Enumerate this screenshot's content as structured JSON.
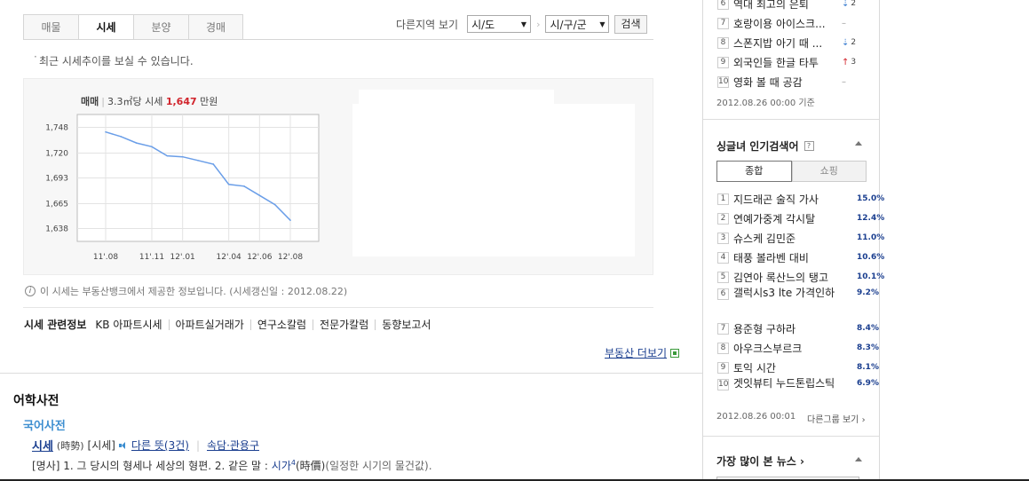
{
  "tabs": [
    {
      "label": "매물"
    },
    {
      "label": "시세"
    },
    {
      "label": "분양"
    },
    {
      "label": "경매"
    }
  ],
  "region": {
    "label": "다른지역 보기",
    "sido": "시/도",
    "sigungu": "시/구/군",
    "search_button": "검색"
  },
  "notice": "최근 시세추이를 보실 수 있습니다.",
  "chart_header": {
    "deal_type": "매매",
    "unit_area": "3.3㎡당 시세",
    "price": "1,647",
    "unit": "만원"
  },
  "chart_data": {
    "type": "line",
    "title": "",
    "xlabel": "",
    "ylabel": "",
    "x_ticks": [
      "11'.08",
      "11'.11",
      "12'.01",
      "12'.04",
      "12'.06",
      "12'.08"
    ],
    "y_ticks": [
      "1,748",
      "1,720",
      "1,693",
      "1,665",
      "1,638"
    ],
    "ylim": [
      1624,
      1762
    ],
    "grid": true,
    "series": [
      {
        "x": [
          "11'.08",
          "11'.09",
          "11'.10",
          "11'.11",
          "11'.12",
          "12'.01",
          "12'.02",
          "12'.03",
          "12'.04",
          "12'.05",
          "12'.06",
          "12'.07",
          "12'.08"
        ],
        "values": [
          1743,
          1738,
          1731,
          1727,
          1717,
          1716,
          1712,
          1708,
          1686,
          1684,
          1674,
          1664,
          1647
        ]
      }
    ],
    "line_color": "#6a9ee8"
  },
  "source_note": "이 시세는 부동산뱅크에서 제공한 정보입니다. (시세갱신일 : 2012.08.22)",
  "related": {
    "head": "시세 관련정보",
    "links": [
      "KB 아파트시세",
      "아파트실거래가",
      "연구소칼럼",
      "전문가칼럼",
      "동향보고서"
    ]
  },
  "more_realestate": "부동산 더보기",
  "dictionary": {
    "title": "어학사전",
    "subtitle": "국어사전",
    "word": "시세",
    "hanja": "(時勢)",
    "pron": "[시세]",
    "other_meanings": "다른 뜻(3건)",
    "proverb": "속담·관용구",
    "def_prefix": "[명사] 1. 그 당시의 형세나 세상의 형편. 2. 같은 말 :",
    "def_link": "시가",
    "def_sup": "4",
    "def_hanja": "(時價)",
    "def_suffix": "(일정한 시기의 물건값)."
  },
  "top_list": {
    "items": [
      {
        "num": "6",
        "text": "역대 최고의 은퇴",
        "change": "2",
        "dir": "down"
      },
      {
        "num": "7",
        "text": "호랑이용 아이스크...",
        "change": "",
        "dir": "same"
      },
      {
        "num": "8",
        "text": "스폰지밥 아기 때 ...",
        "change": "2",
        "dir": "down"
      },
      {
        "num": "9",
        "text": "외국인들 한글 타투",
        "change": "3",
        "dir": "up"
      },
      {
        "num": "10",
        "text": "영화 볼 때 공감",
        "change": "",
        "dir": "same"
      }
    ],
    "stamp": "2012.08.26 00:00 기준"
  },
  "single_search": {
    "title": "싱글녀 인기검색어",
    "help": "?",
    "subtabs": [
      "종합",
      "쇼핑"
    ],
    "items": [
      {
        "num": "1",
        "text": "지드래곤 술직 가사",
        "pct": "15.0%"
      },
      {
        "num": "2",
        "text": "연예가중계 각시탈",
        "pct": "12.4%"
      },
      {
        "num": "3",
        "text": "슈스케 김민준",
        "pct": "11.0%"
      },
      {
        "num": "4",
        "text": "태풍 볼라벤 대비",
        "pct": "10.6%"
      },
      {
        "num": "5",
        "text": "김연아 록산느의 탱고",
        "pct": "10.1%"
      },
      {
        "num": "6",
        "text": "갤럭시s3 lte 가격인하",
        "pct": "9.2%"
      },
      {
        "num": "7",
        "text": "용준형 구하라",
        "pct": "8.4%"
      },
      {
        "num": "8",
        "text": "아우크스부르크",
        "pct": "8.3%"
      },
      {
        "num": "9",
        "text": "토익 시간",
        "pct": "8.1%"
      },
      {
        "num": "10",
        "text": "겟잇뷰티 누드톤립스틱",
        "pct": "6.9%"
      }
    ],
    "stamp": "2012.08.26 00:01",
    "other_group": "다른그룹 보기"
  },
  "most_viewed": {
    "title": "가장 많이 본 뉴스 ›"
  }
}
